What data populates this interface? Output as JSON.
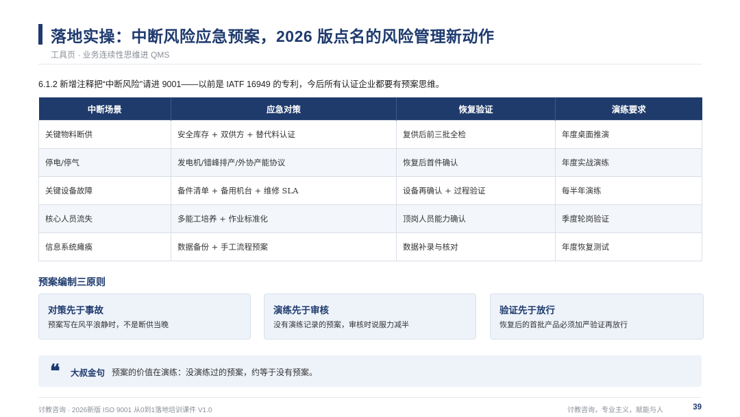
{
  "header": {
    "title": "落地实操：中断风险应急预案，2026 版点名的风险管理新动作",
    "subtitle": "工具页 · 业务连续性思维进 QMS"
  },
  "intro": "6.1.2 新增注释把“中断风险”请进 9001——以前是 IATF 16949 的专利，今后所有认证企业都要有预案思维。",
  "table": {
    "headers": [
      "中断场景",
      "应急对策",
      "恢复验证",
      "演练要求"
    ],
    "rows": [
      [
        "关键物料断供",
        "安全库存 + 双供方 + 替代料认证",
        "复供后前三批全检",
        "年度桌面推演"
      ],
      [
        "停电/停气",
        "发电机/错峰排产/外协产能协议",
        "恢复后首件确认",
        "年度实战演练"
      ],
      [
        "关键设备故障",
        "备件清单 + 备用机台 + 维修 SLA",
        "设备再确认 + 过程验证",
        "每半年演练"
      ],
      [
        "核心人员流失",
        "多能工培养 + 作业标准化",
        "顶岗人员能力确认",
        "季度轮岗验证"
      ],
      [
        "信息系统瘫痪",
        "数据备份 + 手工流程预案",
        "数据补录与核对",
        "年度恢复测试"
      ]
    ]
  },
  "principles": {
    "heading": "预案编制三原则",
    "cards": [
      {
        "title": "对策先于事故",
        "desc": "预案写在风平浪静时，不是断供当晚"
      },
      {
        "title": "演练先于审核",
        "desc": "没有演练记录的预案，审核时说服力减半"
      },
      {
        "title": "验证先于放行",
        "desc": "恢复后的首批产品必须加严验证再放行"
      }
    ]
  },
  "quote": {
    "icon": "quote-icon",
    "label": "大叔金句",
    "text": "预案的价值在演练：没演练过的预案，约等于没有预案。"
  },
  "footer": {
    "left": "讨教咨询 · 2026新版 ISO 9001 从0到1落地培训课件 V1.0",
    "right": "讨教咨询，专业主义，赋能与人",
    "page": "39"
  },
  "colors": {
    "primary": "#1e3a6e",
    "header_bg": "#1f3b6b",
    "card_bg": "#eef3fa"
  }
}
